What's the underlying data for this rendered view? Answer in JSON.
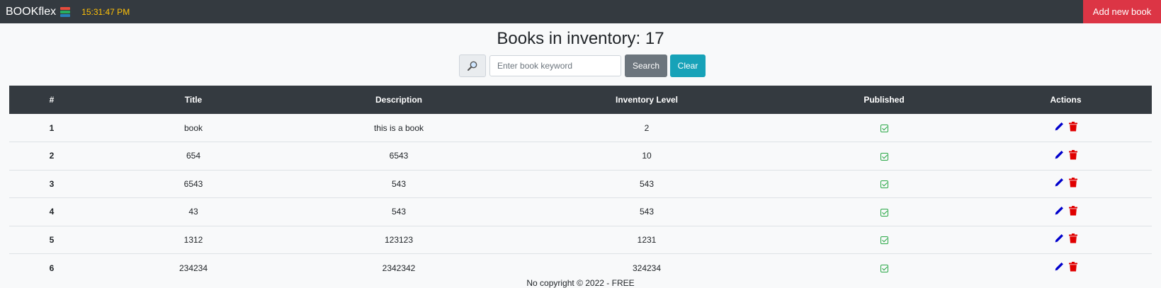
{
  "navbar": {
    "brand": "BOOKflex",
    "brand_icon": "books-icon",
    "clock": "15:31:47 PM",
    "add_button": "Add new book"
  },
  "page": {
    "title": "Books in inventory: 17"
  },
  "search": {
    "placeholder": "Enter book keyword",
    "value": "",
    "search_label": "Search",
    "clear_label": "Clear",
    "icon": "magnifier-icon"
  },
  "table": {
    "headers": [
      "#",
      "Title",
      "Description",
      "Inventory Level",
      "Published",
      "Actions"
    ],
    "rows": [
      {
        "num": "1",
        "title": "book",
        "description": "this is a book",
        "inventory": "2",
        "published": true
      },
      {
        "num": "2",
        "title": "654",
        "description": "6543",
        "inventory": "10",
        "published": true
      },
      {
        "num": "3",
        "title": "6543",
        "description": "543",
        "inventory": "543",
        "published": true
      },
      {
        "num": "4",
        "title": "43",
        "description": "543",
        "inventory": "543",
        "published": true
      },
      {
        "num": "5",
        "title": "1312",
        "description": "123123",
        "inventory": "1231",
        "published": true
      },
      {
        "num": "6",
        "title": "234234",
        "description": "2342342",
        "inventory": "324234",
        "published": true
      }
    ]
  },
  "footer": {
    "text": "No copyright © 2022 - FREE"
  },
  "colors": {
    "navbar": "#343a40",
    "clock": "#ffc107",
    "add_button": "#dc3545",
    "search_button": "#6c757d",
    "clear_button": "#17a2b8",
    "edit_icon": "#0000cc",
    "delete_icon": "#e00000",
    "published_check": "#28a745"
  }
}
